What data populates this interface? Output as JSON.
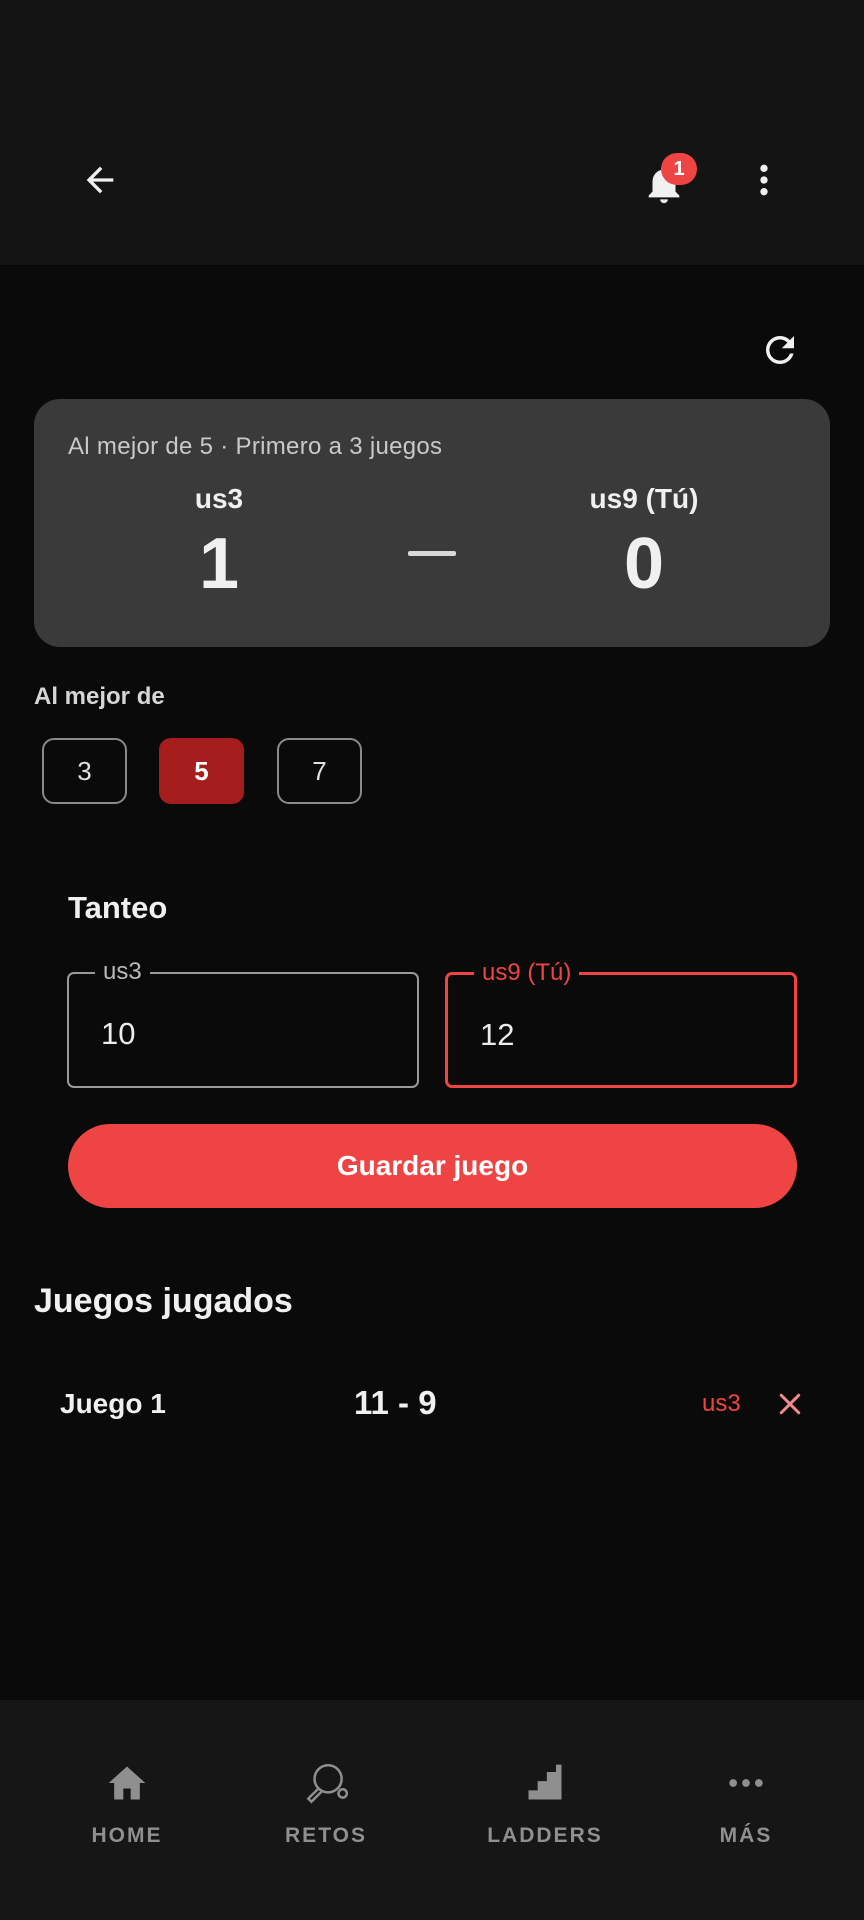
{
  "header": {
    "notification_count": "1"
  },
  "match": {
    "subtitle": "Al mejor de 5 · Primero a 3 juegos",
    "player1": {
      "name": "us3",
      "games": "1"
    },
    "player2": {
      "name": "us9 (Tú)",
      "games": "0"
    }
  },
  "best_of": {
    "label": "Al mejor de",
    "options": [
      "3",
      "5",
      "7"
    ],
    "selected": "5"
  },
  "tanteo": {
    "title": "Tanteo",
    "field1": {
      "label": "us3",
      "value": "10"
    },
    "field2": {
      "label": "us9 (Tú)",
      "value": "12"
    },
    "save_label": "Guardar juego"
  },
  "played": {
    "title": "Juegos jugados",
    "games": [
      {
        "name": "Juego 1",
        "score": "11 - 9",
        "winner": "us3"
      }
    ]
  },
  "nav": {
    "items": [
      {
        "label": "HOME",
        "icon": "home-icon"
      },
      {
        "label": "RETOS",
        "icon": "ping-pong-paddle-icon"
      },
      {
        "label": "LADDERS",
        "icon": "stairs-icon"
      },
      {
        "label": "MÁS",
        "icon": "more-horizontal-icon"
      }
    ]
  },
  "colors": {
    "accent": "#ef4444",
    "selected": "#a51d1d",
    "card": "#3a3a3a",
    "background": "#0a0a0a"
  }
}
